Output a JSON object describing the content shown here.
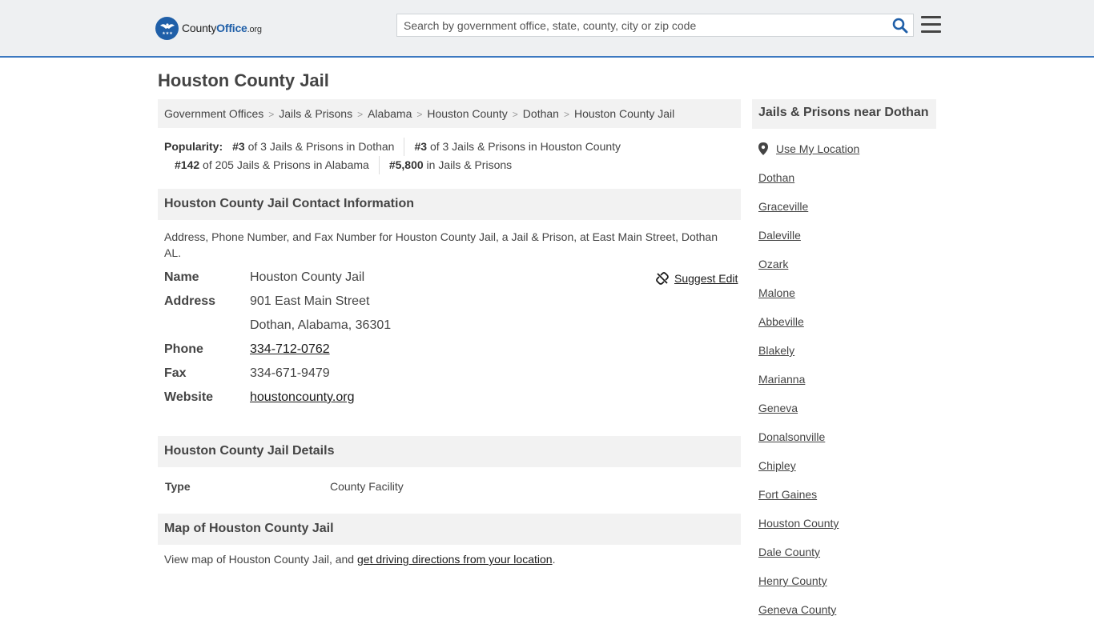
{
  "header": {
    "logo_prefix": "County",
    "logo_strong": "Office",
    "logo_tld": ".org",
    "search_placeholder": "Search by government office, state, county, city or zip code",
    "brand_color": "#1f5fa8"
  },
  "page_title": "Houston County Jail",
  "breadcrumb": [
    "Government Offices",
    "Jails & Prisons",
    "Alabama",
    "Houston County",
    "Dothan",
    "Houston County Jail"
  ],
  "popularity": {
    "label": "Popularity:",
    "items": [
      {
        "rank": "#3",
        "text": "of 3 Jails & Prisons in Dothan"
      },
      {
        "rank": "#3",
        "text": "of 3 Jails & Prisons in Houston County"
      },
      {
        "rank": "#142",
        "text": "of 205 Jails & Prisons in Alabama"
      },
      {
        "rank": "#5,800",
        "text": "in Jails & Prisons"
      }
    ]
  },
  "contact": {
    "heading": "Houston County Jail Contact Information",
    "description": "Address, Phone Number, and Fax Number for Houston County Jail, a Jail & Prison, at East Main Street, Dothan AL.",
    "suggest_edit": "Suggest Edit",
    "name_label": "Name",
    "name": "Houston County Jail",
    "address_label": "Address",
    "address_line1": "901 East Main Street",
    "address_line2": "Dothan, Alabama, 36301",
    "phone_label": "Phone",
    "phone": "334-712-0762",
    "fax_label": "Fax",
    "fax": "334-671-9479",
    "website_label": "Website",
    "website": "houstoncounty.org"
  },
  "details": {
    "heading": "Houston County Jail Details",
    "type_label": "Type",
    "type_value": "County Facility"
  },
  "map": {
    "heading": "Map of Houston County Jail",
    "text_before": "View map of Houston County Jail, and ",
    "link": "get driving directions from your location",
    "text_after": "."
  },
  "sidebar": {
    "heading": "Jails & Prisons near Dothan",
    "use_location": "Use My Location",
    "links": [
      "Dothan",
      "Graceville",
      "Daleville",
      "Ozark",
      "Malone",
      "Abbeville",
      "Blakely",
      "Marianna",
      "Geneva",
      "Donalsonville",
      "Chipley",
      "Fort Gaines",
      "Houston County",
      "Dale County",
      "Henry County",
      "Geneva County"
    ]
  }
}
